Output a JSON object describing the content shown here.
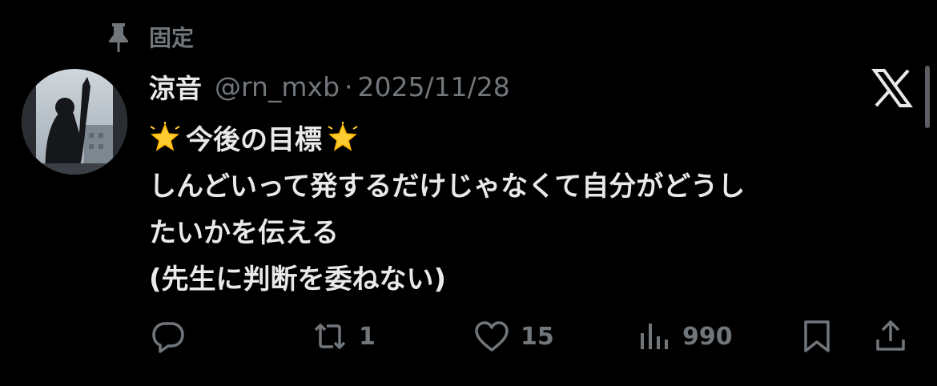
{
  "pinned": {
    "label": "固定"
  },
  "post": {
    "display_name": "涼音",
    "handle": "@rn_mxb",
    "separator": "·",
    "date": "2025/11/28",
    "body_lines": [
      "今後の目標",
      "しんどいって発するだけじゃなくて自分がどうし",
      "たいかを伝える",
      "(先生に判断を委ねない)"
    ]
  },
  "actions": {
    "reply": {
      "icon": "reply-icon"
    },
    "repost": {
      "icon": "repost-icon",
      "count": "1"
    },
    "like": {
      "icon": "heart-icon",
      "count": "15"
    },
    "views": {
      "icon": "views-icon",
      "count": "990"
    },
    "bookmark": {
      "icon": "bookmark-icon"
    },
    "share": {
      "icon": "share-icon"
    }
  },
  "colors": {
    "background": "#000000",
    "text": "#e7e9ea",
    "muted": "#71767b"
  }
}
